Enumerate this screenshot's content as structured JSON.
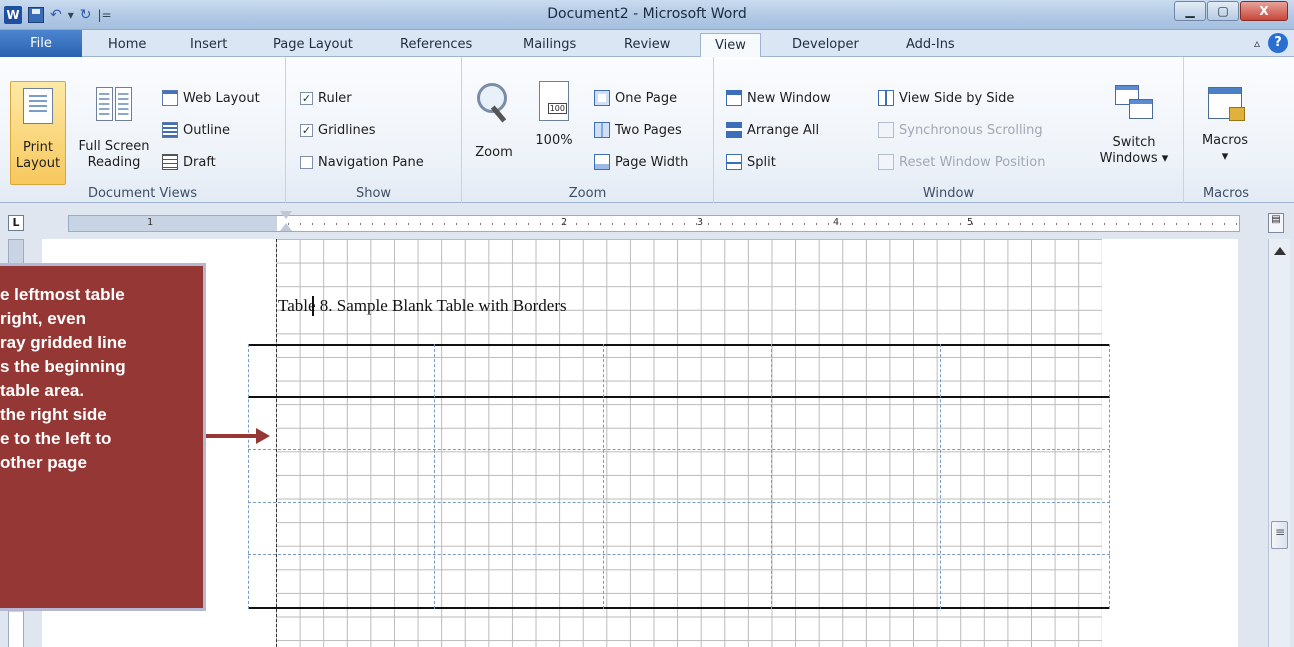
{
  "window": {
    "title": "Document2 - Microsoft Word",
    "minimize": "▁",
    "maximize": "▢",
    "close": "X"
  },
  "quick_access": {
    "app_icon": "W",
    "undo": "↶",
    "undo_caret": "▾",
    "redo": "↻",
    "customize": "|="
  },
  "tabs": [
    "File",
    "Home",
    "Insert",
    "Page Layout",
    "References",
    "Mailings",
    "Review",
    "View",
    "Developer",
    "Add-Ins"
  ],
  "active_tab": "View",
  "help": "?",
  "ribbon": {
    "document_views": {
      "label": "Document Views",
      "print_layout": [
        "Print",
        "Layout"
      ],
      "full_screen": [
        "Full Screen",
        "Reading"
      ],
      "web_layout": "Web Layout",
      "outline": "Outline",
      "draft": "Draft"
    },
    "show": {
      "label": "Show",
      "ruler": "Ruler",
      "ruler_checked": true,
      "gridlines": "Gridlines",
      "gridlines_checked": true,
      "navigation_pane": "Navigation Pane",
      "navigation_pane_checked": false,
      "check_mark": "✓"
    },
    "zoom": {
      "label": "Zoom",
      "zoom": "Zoom",
      "hundred": "100%",
      "hundred_icon_text": "100",
      "one_page": "One Page",
      "two_pages": "Two Pages",
      "page_width": "Page Width"
    },
    "window": {
      "label": "Window",
      "new_window": "New Window",
      "arrange_all": "Arrange All",
      "split": "Split",
      "view_side_by_side": "View Side by Side",
      "synchronous_scrolling": "Synchronous Scrolling",
      "reset_window_position": "Reset Window Position",
      "switch_windows": [
        "Switch",
        "Windows ▾"
      ]
    },
    "macros": {
      "label": "Macros",
      "macros": [
        "Macros",
        "▾"
      ]
    }
  },
  "ruler": {
    "corner": "L",
    "numbers": [
      "1",
      "2",
      "3",
      "4",
      "5"
    ]
  },
  "document": {
    "caption": "Table 8. Sample Blank Table with Borders"
  },
  "callout": {
    "lines": [
      "e leftmost table",
      " right, even",
      "ray gridded line",
      "s the beginning",
      " table area.",
      " the right side",
      "e to the left to",
      "other page"
    ]
  },
  "colors": {
    "callout_bg": "#953735",
    "file_tab": "#2a62b0",
    "active_view_button": "#f7c85c"
  }
}
